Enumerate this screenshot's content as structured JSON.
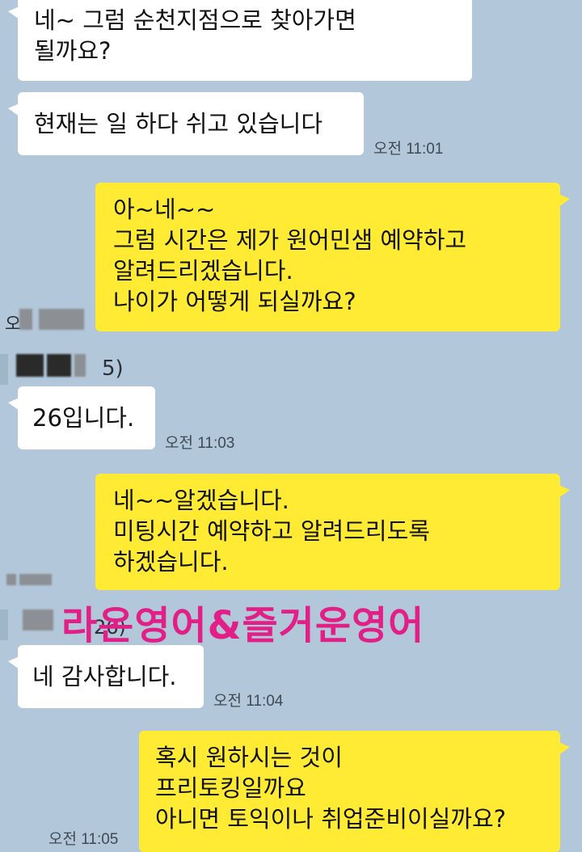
{
  "messages": [
    {
      "side": "left",
      "text": "네~ 그럼 순천지점으로 찾아가면\n될까요?",
      "time": ""
    },
    {
      "side": "left",
      "text": "현재는 일 하다 쉬고 있습니다",
      "time": "오전 11:01"
    },
    {
      "side": "right",
      "text": "아~네~~\n그럼 시간은 제가 원어민샘 예약하고\n알려드리겠습니다.\n나이가 어떻게 되실까요?",
      "time": ""
    },
    {
      "side": "left",
      "text": "26입니다.",
      "time": "오전 11:03"
    },
    {
      "side": "right",
      "text": "네~~알겠습니다.\n미팅시간 예약하고 알려드리도록\n하겠습니다.",
      "time": ""
    },
    {
      "side": "left",
      "text": "네 감사합니다.",
      "time": "오전 11:04"
    },
    {
      "side": "right",
      "text": "혹시 원하시는 것이\n프리토킹일까요\n아니면 토익이나 취업준비이실까요?",
      "time": "오전 11:05"
    }
  ],
  "sender_fragments": [
    "오",
    "5)",
    "2",
    "26)"
  ],
  "watermark": "라온영어&즐거운영어",
  "colors": {
    "background": "#b2c7d9",
    "my_bubble": "#ffeb33",
    "their_bubble": "#ffffff",
    "watermark": "#e21f86"
  }
}
